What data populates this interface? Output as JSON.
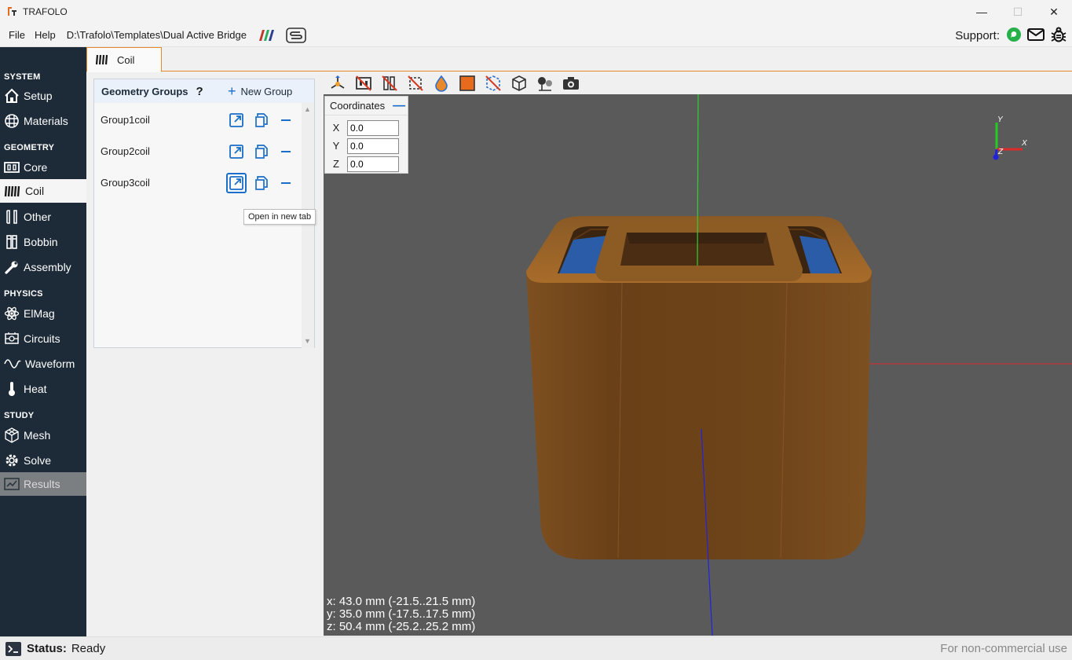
{
  "app": {
    "title": "TRAFOLO"
  },
  "menu": {
    "file": "File",
    "help": "Help",
    "path": "D:\\Trafolo\\Templates\\Dual Active Bridge"
  },
  "support": {
    "label": "Support:"
  },
  "sidebar": {
    "sections": {
      "system": "SYSTEM",
      "geometry": "GEOMETRY",
      "physics": "PHYSICS",
      "study": "STUDY"
    },
    "items": {
      "setup": "Setup",
      "materials": "Materials",
      "core": "Core",
      "coil": "Coil",
      "other": "Other",
      "bobbin": "Bobbin",
      "assembly": "Assembly",
      "elmag": "ElMag",
      "circuits": "Circuits",
      "waveform": "Waveform",
      "heat": "Heat",
      "mesh": "Mesh",
      "solve": "Solve",
      "results": "Results"
    },
    "active": "Coil"
  },
  "tab": {
    "label": "Coil"
  },
  "geometry_groups": {
    "title": "Geometry Groups",
    "help": "?",
    "new_group": "New Group",
    "groups": [
      "Group1coil",
      "Group2coil",
      "Group3coil"
    ],
    "tooltip": "Open in new tab"
  },
  "coordinates": {
    "title": "Coordinates",
    "x_label": "X",
    "y_label": "Y",
    "z_label": "Z",
    "x": "0.0",
    "y": "0.0",
    "z": "0.0"
  },
  "axes": {
    "x": "X",
    "y": "Y",
    "z": "Z"
  },
  "dimensions": {
    "x": "x: 43.0 mm (-21.5..21.5 mm)",
    "y": "y: 35.0 mm (-17.5..17.5 mm)",
    "z": "z: 50.4 mm (-25.2..25.2 mm)"
  },
  "status": {
    "label": "Status:",
    "value": "Ready",
    "license": "For non-commercial use"
  },
  "colors": {
    "sidebar_bg": "#1d2a38",
    "accent": "#e8892b",
    "link": "#1a6dc9",
    "viewport_bg": "#5a5a5a",
    "coil": "#7a4a1c",
    "winding": "#2255a8"
  }
}
